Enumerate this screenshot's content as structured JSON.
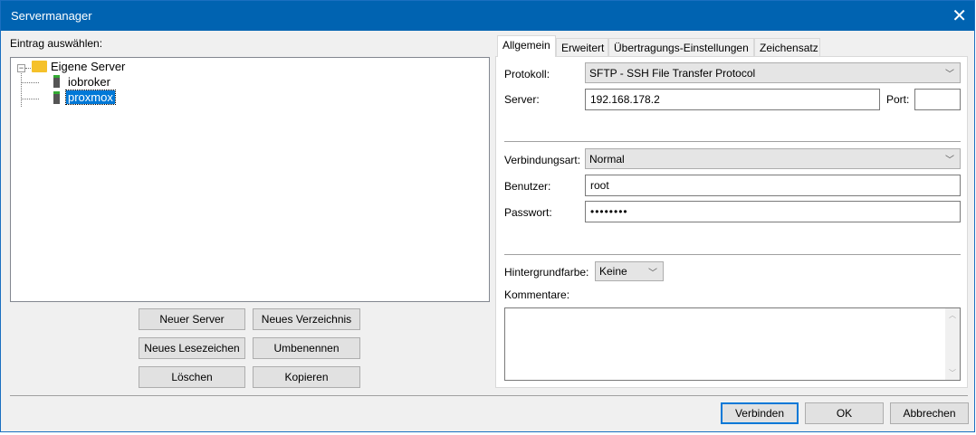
{
  "window": {
    "title": "Servermanager"
  },
  "left": {
    "label": "Eintrag auswählen:",
    "tree": {
      "root": "Eigene Server",
      "children": [
        "iobroker",
        "proxmox"
      ],
      "selected": "proxmox"
    },
    "buttons": {
      "new_server": "Neuer Server",
      "new_folder": "Neues Verzeichnis",
      "new_bookmark": "Neues Lesezeichen",
      "rename": "Umbenennen",
      "delete": "Löschen",
      "copy": "Kopieren"
    }
  },
  "tabs": [
    "Allgemein",
    "Erweitert",
    "Übertragungs-Einstellungen",
    "Zeichensatz"
  ],
  "general": {
    "protocol_label": "Protokoll:",
    "protocol": "SFTP - SSH File Transfer Protocol",
    "server_label": "Server:",
    "server": "192.168.178.2",
    "port_label": "Port:",
    "port": "",
    "logon_label": "Verbindungsart:",
    "logon": "Normal",
    "user_label": "Benutzer:",
    "user": "root",
    "password_label": "Passwort:",
    "password": "••••••••",
    "bg_label": "Hintergrundfarbe:",
    "bg": "Keine",
    "comments_label": "Kommentare:",
    "comments": ""
  },
  "footer": {
    "connect": "Verbinden",
    "ok": "OK",
    "cancel": "Abbrechen"
  }
}
